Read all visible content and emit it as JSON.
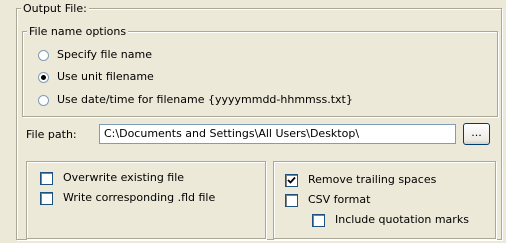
{
  "output_file": {
    "title": "Output File:",
    "name_options": {
      "title": "File name options",
      "options": [
        {
          "label": "Specify file name",
          "selected": false
        },
        {
          "label": "Use unit filename",
          "selected": true
        },
        {
          "label": "Use date/time for filename {yyyymmdd-hhmmss.txt}",
          "selected": false
        }
      ]
    },
    "file_path": {
      "label": "File path:",
      "value": "C:\\Documents and Settings\\All Users\\Desktop\\",
      "browse_label": "..."
    },
    "left_checks": [
      {
        "label": "Overwrite existing file",
        "checked": false
      },
      {
        "label": "Write corresponding .fld file",
        "checked": false
      }
    ],
    "right_checks": [
      {
        "label": "Remove trailing spaces",
        "checked": true
      },
      {
        "label": "CSV format",
        "checked": false
      },
      {
        "label": "Include quotation marks",
        "checked": false
      }
    ]
  }
}
